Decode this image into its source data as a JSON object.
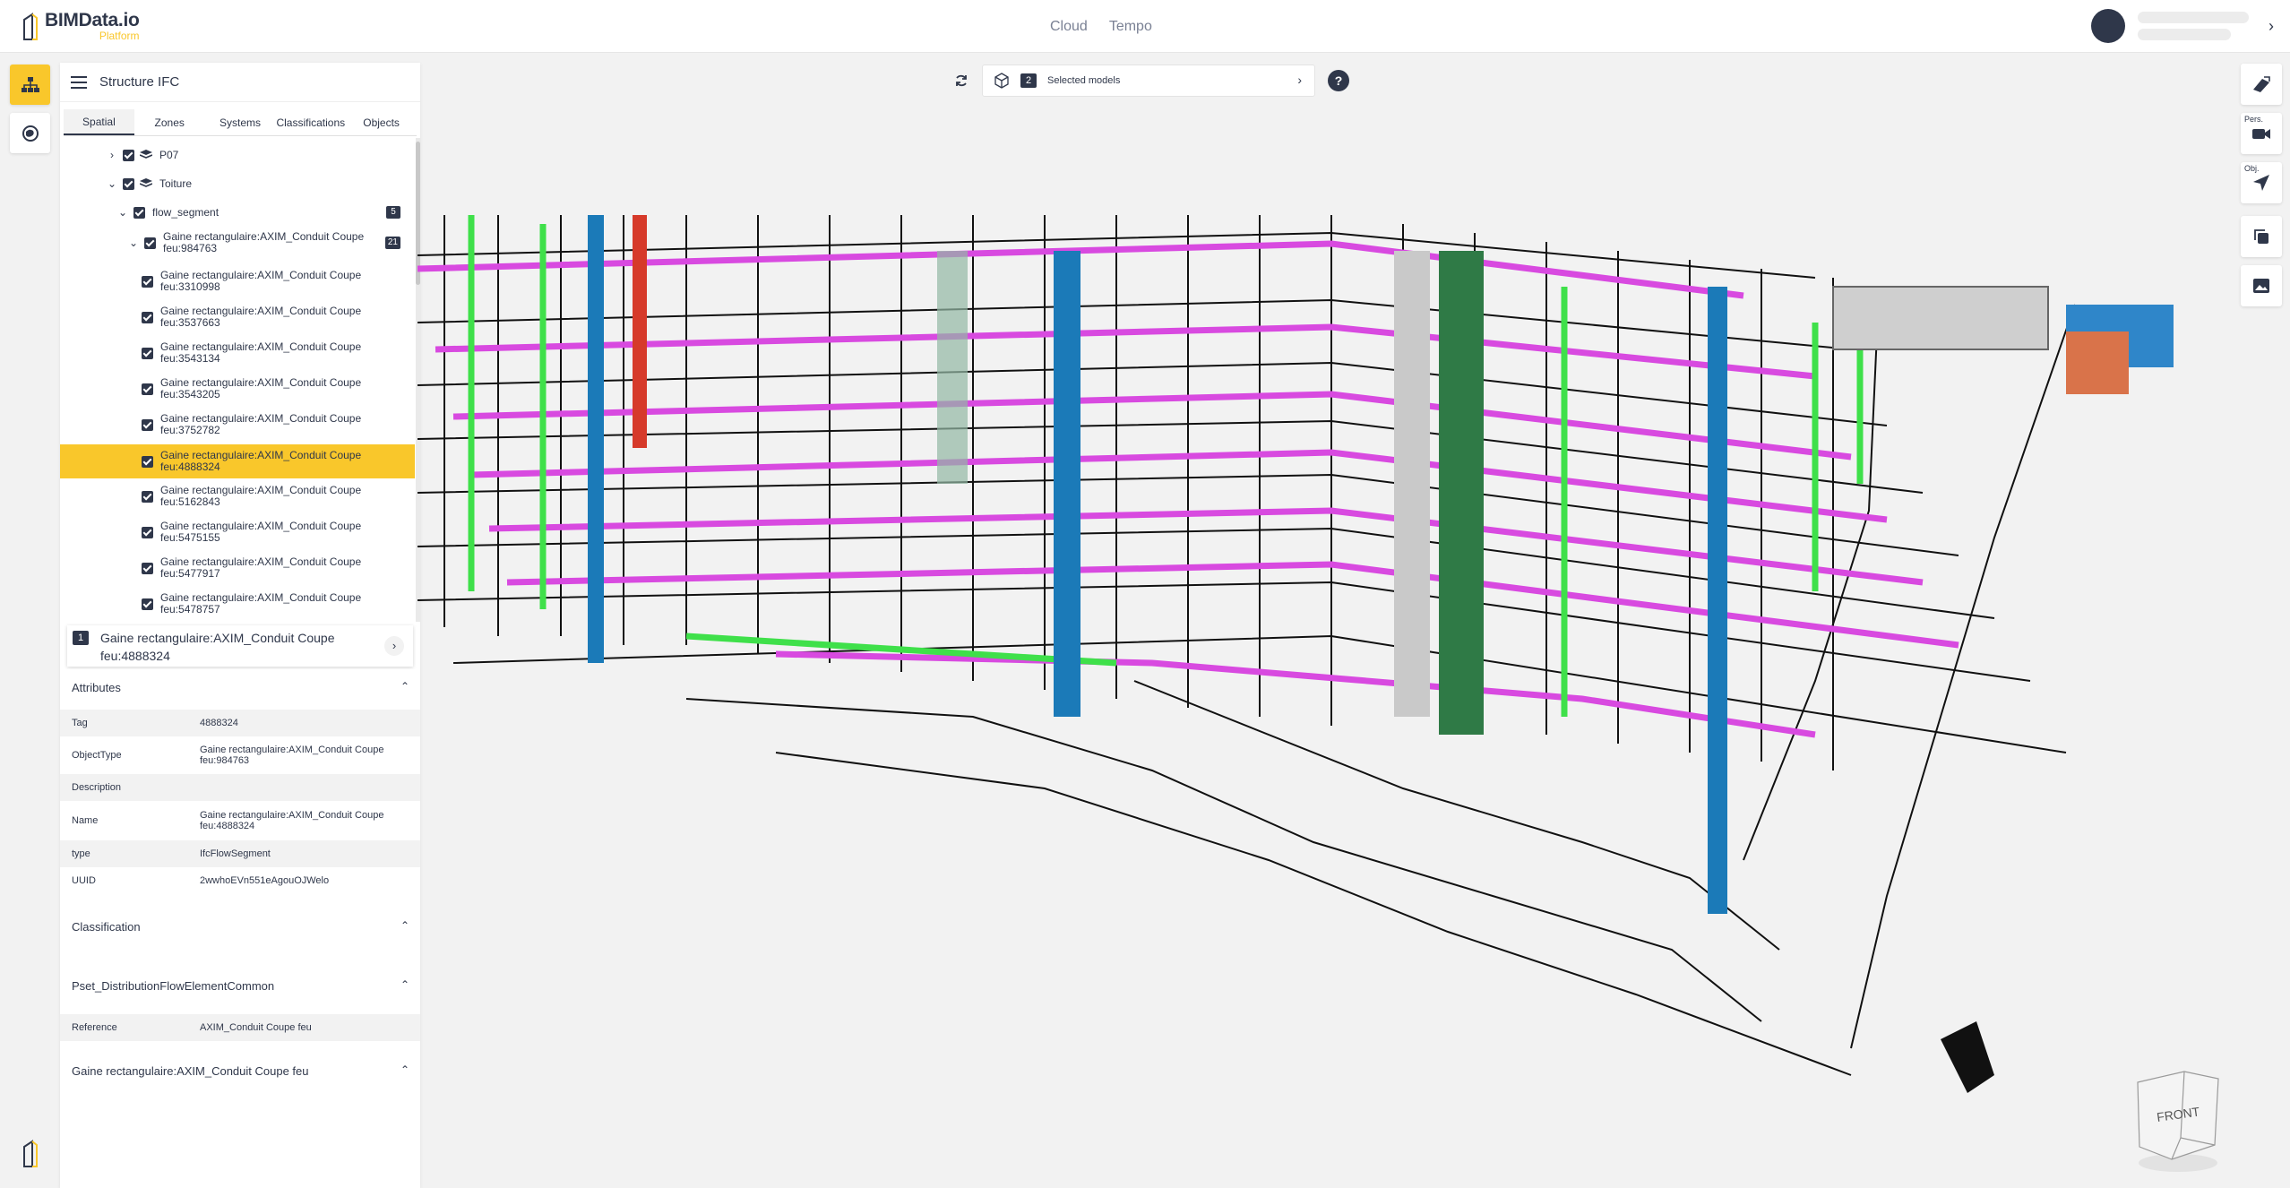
{
  "app": {
    "logo_title": "BIMData.io",
    "logo_sub": "Platform",
    "nav": [
      "Cloud",
      "Tempo"
    ],
    "accent": "#f9c72b",
    "dark": "#2f374a"
  },
  "panel": {
    "title": "Structure IFC",
    "tabs": [
      "Spatial",
      "Zones",
      "Systems",
      "Classifications",
      "Objects"
    ],
    "active_tab": "Spatial",
    "tree": {
      "p07": "P07",
      "toiture": "Toiture",
      "flow_segment": "flow_segment",
      "flow_segment_count": "5",
      "group_line1": "Gaine rectangulaire:AXIM_Conduit Coupe",
      "group_line2": "feu:984763",
      "group_count": "21",
      "items": [
        {
          "line1": "Gaine rectangulaire:AXIM_Conduit Coupe",
          "line2": "feu:3310998"
        },
        {
          "line1": "Gaine rectangulaire:AXIM_Conduit Coupe",
          "line2": "feu:3537663"
        },
        {
          "line1": "Gaine rectangulaire:AXIM_Conduit Coupe",
          "line2": "feu:3543134"
        },
        {
          "line1": "Gaine rectangulaire:AXIM_Conduit Coupe",
          "line2": "feu:3543205"
        },
        {
          "line1": "Gaine rectangulaire:AXIM_Conduit Coupe",
          "line2": "feu:3752782"
        },
        {
          "line1": "Gaine rectangulaire:AXIM_Conduit Coupe",
          "line2": "feu:4888324"
        },
        {
          "line1": "Gaine rectangulaire:AXIM_Conduit Coupe",
          "line2": "feu:5162843"
        },
        {
          "line1": "Gaine rectangulaire:AXIM_Conduit Coupe",
          "line2": "feu:5475155"
        },
        {
          "line1": "Gaine rectangulaire:AXIM_Conduit Coupe",
          "line2": "feu:5477917"
        },
        {
          "line1": "Gaine rectangulaire:AXIM_Conduit Coupe",
          "line2": "feu:5478757"
        }
      ]
    },
    "selection": {
      "count": "1",
      "line1": "Gaine rectangulaire:AXIM_Conduit Coupe",
      "line2": "feu:4888324"
    },
    "attributes": {
      "title": "Attributes",
      "rows": [
        {
          "key": "Tag",
          "val1": "4888324",
          "val2": ""
        },
        {
          "key": "ObjectType",
          "val1": "Gaine rectangulaire:AXIM_Conduit Coupe",
          "val2": "feu:984763"
        },
        {
          "key": "Description",
          "val1": "",
          "val2": ""
        },
        {
          "key": "Name",
          "val1": "Gaine rectangulaire:AXIM_Conduit Coupe",
          "val2": "feu:4888324"
        },
        {
          "key": "type",
          "val1": "IfcFlowSegment",
          "val2": ""
        },
        {
          "key": "UUID",
          "val1": "2wwhoEVn551eAgouOJWelo",
          "val2": ""
        }
      ]
    },
    "classification_title": "Classification",
    "pset": {
      "title": "Pset_DistributionFlowElementCommon",
      "rows": [
        {
          "key": "Reference",
          "val": "AXIM_Conduit Coupe feu"
        }
      ]
    },
    "type_section_title": "Gaine rectangulaire:AXIM_Conduit Coupe feu"
  },
  "viewer": {
    "models_count": "2",
    "models_label": "Selected models",
    "help": "?",
    "right_labels": {
      "pers": "Pers.",
      "obj": "Obj."
    },
    "navcube_face": "FRONT"
  }
}
